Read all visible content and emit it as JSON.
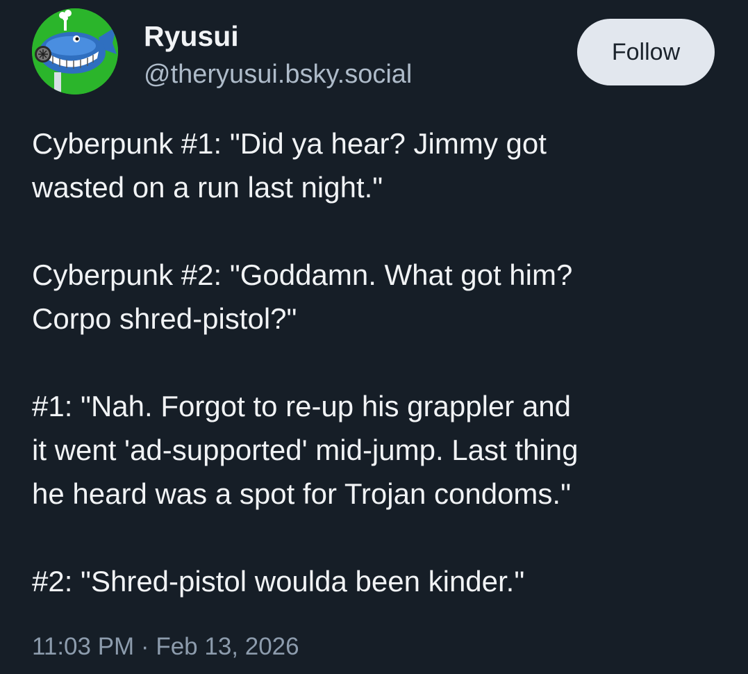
{
  "author": {
    "display_name": "Ryusui",
    "handle": "@theryusui.bsky.social",
    "avatar_icon": "whale-avatar-icon"
  },
  "actions": {
    "follow_label": "Follow"
  },
  "post": {
    "paragraphs": [
      "Cyberpunk #1: \"Did ya hear? Jimmy got\nwasted on a run last night.\"",
      "Cyberpunk #2: \"Goddamn. What got him?\nCorpo shred-pistol?\"",
      "#1: \"Nah. Forgot to re-up his grappler and\nit went 'ad-supported' mid-jump. Last thing\nhe heard was a spot for Trojan condoms.\"",
      "#2: \"Shred-pistol woulda been kinder.\""
    ],
    "timestamp": "11:03 PM · Feb 13, 2026"
  },
  "colors": {
    "background": "#161e27",
    "text": "#f1f3f5",
    "handle": "#aebbc9",
    "follow_bg": "#e2e7ee",
    "avatar_bg": "#2bb52b"
  }
}
